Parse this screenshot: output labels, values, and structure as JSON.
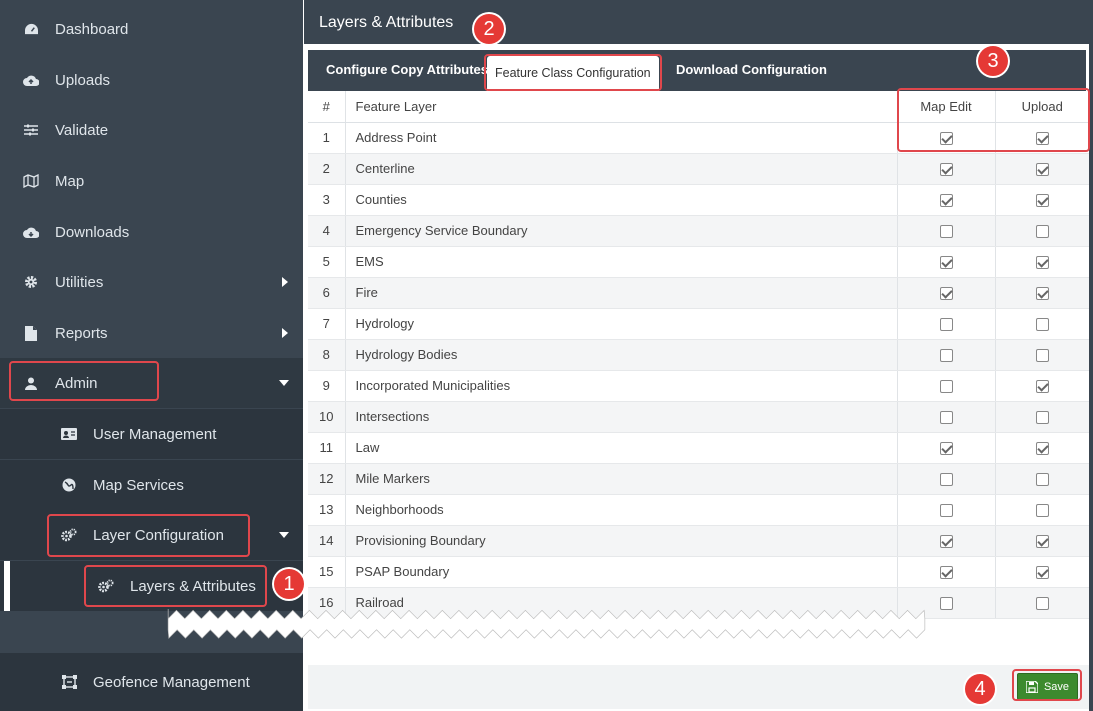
{
  "sidebar": {
    "items": [
      {
        "label": "Dashboard",
        "icon": "dashboard-icon"
      },
      {
        "label": "Uploads",
        "icon": "cloud-upload-icon"
      },
      {
        "label": "Validate",
        "icon": "sliders-icon"
      },
      {
        "label": "Map",
        "icon": "map-icon"
      },
      {
        "label": "Downloads",
        "icon": "cloud-download-icon"
      },
      {
        "label": "Utilities",
        "icon": "gear-icon"
      },
      {
        "label": "Reports",
        "icon": "file-icon"
      },
      {
        "label": "Admin",
        "icon": "user-icon"
      },
      {
        "label": "User Management",
        "icon": "id-card-icon"
      },
      {
        "label": "Map Services",
        "icon": "globe-icon"
      },
      {
        "label": "Layer Configuration",
        "icon": "gears-icon"
      },
      {
        "label": "Layers & Attributes",
        "icon": "gears-icon"
      },
      {
        "label": "Geofence Management",
        "icon": "geofence-icon"
      }
    ]
  },
  "header": {
    "title": "Layers & Attributes"
  },
  "tabs": [
    {
      "label": "Configure Copy Attributes"
    },
    {
      "label": "Feature Class Configuration"
    },
    {
      "label": "Download Configuration"
    }
  ],
  "table": {
    "columns": [
      "#",
      "Feature Layer",
      "Map Edit",
      "Upload"
    ],
    "rows": [
      {
        "num": "1",
        "name": "Address Point",
        "map_edit": true,
        "upload": true
      },
      {
        "num": "2",
        "name": "Centerline",
        "map_edit": true,
        "upload": true
      },
      {
        "num": "3",
        "name": "Counties",
        "map_edit": true,
        "upload": true
      },
      {
        "num": "4",
        "name": "Emergency Service Boundary",
        "map_edit": false,
        "upload": false
      },
      {
        "num": "5",
        "name": "EMS",
        "map_edit": true,
        "upload": true
      },
      {
        "num": "6",
        "name": "Fire",
        "map_edit": true,
        "upload": true
      },
      {
        "num": "7",
        "name": "Hydrology",
        "map_edit": false,
        "upload": false
      },
      {
        "num": "8",
        "name": "Hydrology Bodies",
        "map_edit": false,
        "upload": false
      },
      {
        "num": "9",
        "name": "Incorporated Municipalities",
        "map_edit": false,
        "upload": true
      },
      {
        "num": "10",
        "name": "Intersections",
        "map_edit": false,
        "upload": false
      },
      {
        "num": "11",
        "name": "Law",
        "map_edit": true,
        "upload": true
      },
      {
        "num": "12",
        "name": "Mile Markers",
        "map_edit": false,
        "upload": false
      },
      {
        "num": "13",
        "name": "Neighborhoods",
        "map_edit": false,
        "upload": false
      },
      {
        "num": "14",
        "name": "Provisioning Boundary",
        "map_edit": true,
        "upload": true
      },
      {
        "num": "15",
        "name": "PSAP Boundary",
        "map_edit": true,
        "upload": true
      },
      {
        "num": "16",
        "name": "Railroad",
        "map_edit": false,
        "upload": false
      }
    ]
  },
  "footer": {
    "save_label": "Save"
  },
  "callouts": [
    "1",
    "2",
    "3",
    "4"
  ],
  "colors": {
    "sidebar_bg": "#3a4550",
    "highlight": "#e0474c",
    "badge": "#e53935",
    "save_btn": "#3c8a2e"
  }
}
